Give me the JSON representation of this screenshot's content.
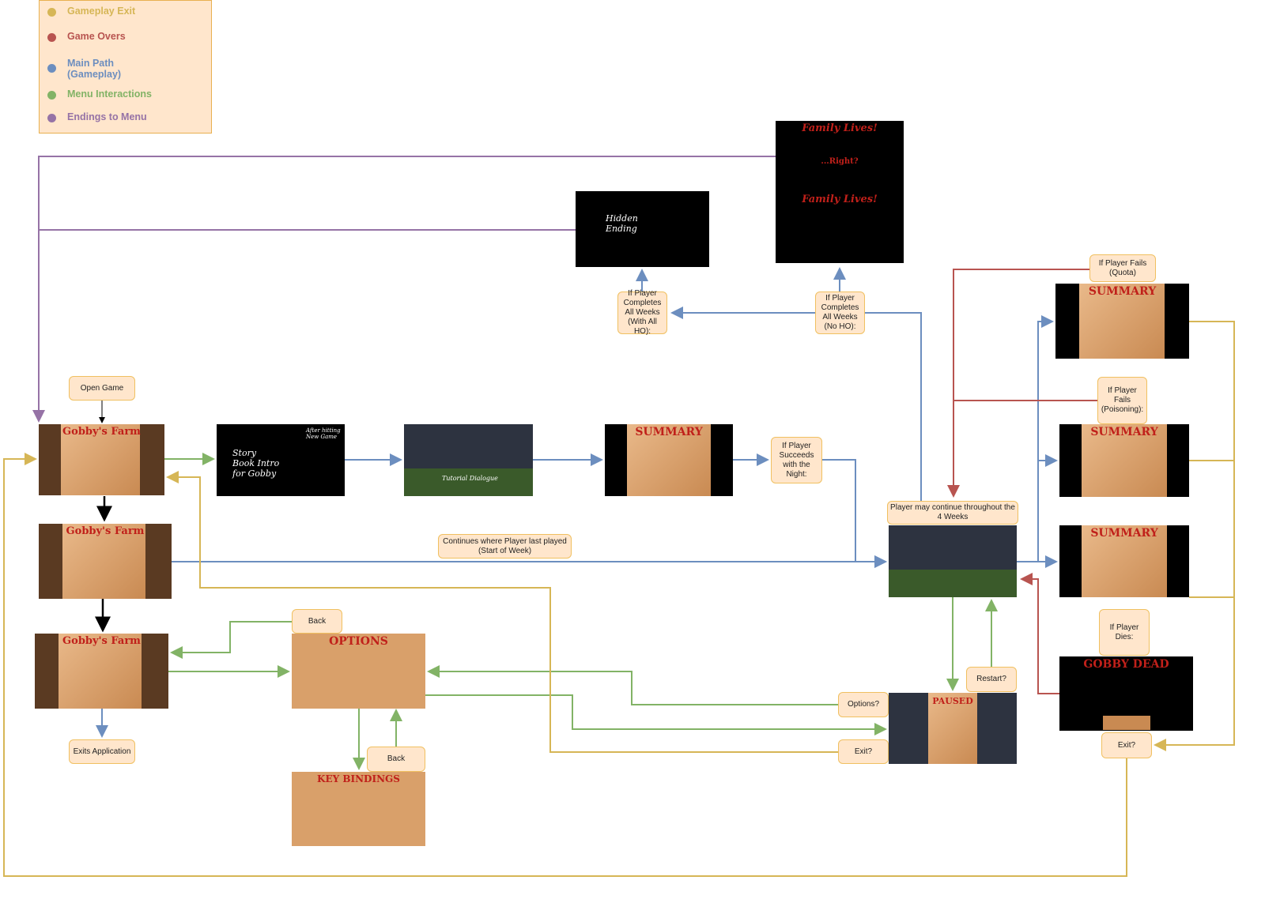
{
  "colors": {
    "gameplay_exit": "#d6b656",
    "game_overs": "#b85450",
    "main_path": "#6c8ebf",
    "menu_interactions": "#82b366",
    "endings_to_menu": "#9673a6"
  },
  "legend": [
    {
      "label": "Gameplay Exit",
      "color": "#d6b656"
    },
    {
      "label": "Game Overs",
      "color": "#b85450"
    },
    {
      "label": "Main Path (Gameplay)",
      "color": "#6c8ebf"
    },
    {
      "label": "Menu Interactions",
      "color": "#82b366"
    },
    {
      "label": "Endings to Menu",
      "color": "#9673a6"
    }
  ],
  "labels": {
    "open_game": "Open Game",
    "exits_application": "Exits Application",
    "succeeds_night": "If Player Succeeds with the Night:",
    "continues": "Continues where Player last played (Start of Week)",
    "player_may_continue": "Player may continue throughout the 4 Weeks",
    "all_weeks_with_ho": "If Player Completes All Weeks (With All HO):",
    "all_weeks_no_ho": "If Player Completes All Weeks (No HO):",
    "fails_quota": "If Player Fails (Quota)",
    "fails_poisoning": "If Player Fails (Poisoning):",
    "dies": "If Player Dies:",
    "exit_right": "Exit?",
    "options_back": "Back",
    "keybind_back": "Back",
    "paused_options": "Options?",
    "paused_exit": "Exit?",
    "paused_restart": "Restart?"
  },
  "screens": {
    "title": "Gobby's Farm",
    "story": "Story Book Intro for Gobby",
    "story_note": "After hitting New Game",
    "tutorial": "Tutorial Dialogue",
    "summary": "SUMMARY",
    "options": "OPTIONS",
    "key_bindings": "KEY BINDINGS",
    "paused": "PAUSED",
    "dead": "GOBBY DEAD",
    "family_lives": "Family Lives!",
    "right": "...Right?",
    "hidden_ending": "Hidden Ending"
  }
}
